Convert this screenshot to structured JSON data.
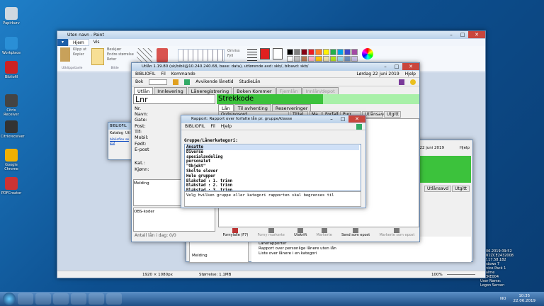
{
  "desktop": {
    "icons": [
      "Papirkurv",
      "Workplace",
      "Bibliofil",
      "Citrix Receiver",
      "Citrixreceiver",
      "Google Chrome",
      "PDFCreator"
    ],
    "info": [
      "22.06.2019 09:52",
      "PCW2ZCE2432008",
      "172.17.58.182",
      "Windows 7",
      "Service Pack 1",
      "amalme",
      "AKERE004"
    ],
    "info_labels": [
      "User Name:",
      "Logon Server:"
    ]
  },
  "taskbar": {
    "time": "10:35",
    "date": "22.06.2019",
    "lang": "NO"
  },
  "paint": {
    "title": "Uten navn - Paint",
    "menu": [
      "Hjem",
      "Vis"
    ],
    "groups": [
      "Utklippstavle",
      "Bilde",
      "Verktøy",
      "Pensler",
      "Figurer",
      "Farger"
    ],
    "tools": [
      "Klipp ut",
      "Kopier",
      "Lim inn",
      "Beskjær",
      "Endre størrelse",
      "Roter",
      "Omriss",
      "Fyll",
      "Størrelse",
      "Farge 1",
      "Farge 2",
      "Rediger farger"
    ],
    "status": {
      "dims": "1920 × 1080px",
      "size": "Størrelse: 1,1MB",
      "zoom": "100%"
    }
  },
  "bib": {
    "title": "Utlån 1.19.80 (sk/bibli@10.240.240.68, base: data), utførende avd: skb/, bibavd: skb/",
    "menu": [
      "BIBLIOFIL",
      "Fil",
      "Kommando"
    ],
    "date": "Lørdag 22 juni 2019",
    "help": "Hjelp",
    "toolbar": {
      "label": "Bok",
      "avd": "Avvikende lånetid",
      "studie": "StudieLån"
    },
    "tabs": [
      "Utlån",
      "Innlevering",
      "Låneregistrering",
      "Boken Kommer",
      "Fjernlån",
      "Innlån/depot"
    ],
    "lnr": "Lnr",
    "strekkode": "Strekkode",
    "fields": [
      "Nr.",
      "Navn:",
      "Gate:",
      "Post:",
      "Tlf:",
      "Mobil:",
      "Født:",
      "E-post",
      "Kat.:",
      "Kjønn:"
    ],
    "subtabs": [
      "Lån",
      "Til avhenting",
      "Reserveringer"
    ],
    "cols": [
      "Ordningsord",
      "Tittel",
      "Ma",
      "Forfall",
      "Purr",
      "Utlånsavd",
      "Utgitt"
    ],
    "melding": "Melding",
    "obs": "OBS-koder",
    "antall": "Antall lån i dag: 0/0",
    "bottom": [
      "Fornylalle (F7)",
      "Forny markerte",
      "Utskrift",
      "Markerte",
      "Send som epost",
      "Markerte som epost"
    ]
  },
  "bib2": {
    "date": "Lørdag 22 juni 2019",
    "help": "Hjelp",
    "cols": [
      "Utlånsavd",
      "Utgitt"
    ],
    "melding": "Melding",
    "lines": [
      "Rapport over forfalte lån etter dato",
      "Lånerapporter",
      "Rapport over personlige lånere uten lån",
      "Liste over lånere i en kategori"
    ]
  },
  "mini": {
    "title": "BIBLIOFIL",
    "items": [
      "Katalog",
      "Utl"
    ],
    "link": "biblioflex sø 2.0"
  },
  "dlg": {
    "title": "Rapport: Rapport over forfalte lån pr. gruppe/klasse",
    "menu": [
      "BIBLIOFIL",
      "Fil",
      "Hjelp"
    ],
    "label": "Gruppe/Lånerkategori:",
    "items": [
      "Ansatte",
      "Diverse",
      "spesialavdeling",
      "personalet",
      "\"Objekt\"",
      "Skolte elever",
      "Hele grupper",
      "Blakstad : 1. trinn",
      "Blakstad : 2. trinn",
      "Blakstad : 3. trinn"
    ],
    "hint": "Velg hvilken gruppe eller kategori rapporten skal begrenses til"
  }
}
